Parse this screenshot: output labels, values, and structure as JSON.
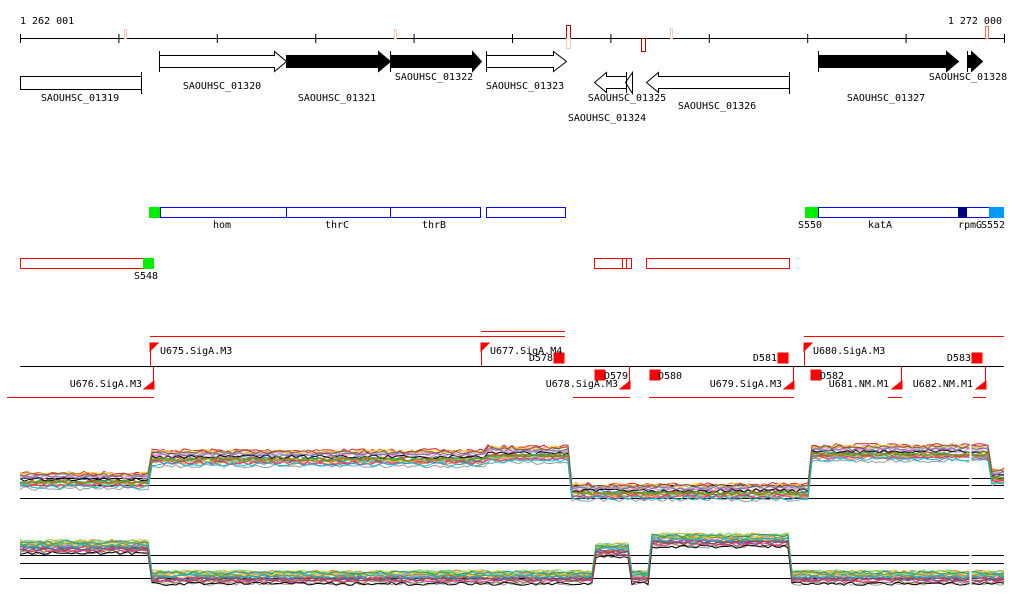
{
  "ruler": {
    "start_label": "1 262 001",
    "end_label": "1 272 000"
  },
  "genes": [
    {
      "id": "SAOUHSC_01319"
    },
    {
      "id": "SAOUHSC_01320"
    },
    {
      "id": "SAOUHSC_01321"
    },
    {
      "id": "SAOUHSC_01322"
    },
    {
      "id": "SAOUHSC_01323"
    },
    {
      "id": "SAOUHSC_01324"
    },
    {
      "id": "SAOUHSC_01325"
    },
    {
      "id": "SAOUHSC_01326"
    },
    {
      "id": "SAOUHSC_01327"
    },
    {
      "id": "SAOUHSC_01328"
    }
  ],
  "gene_names": {
    "hom": "hom",
    "thrC": "thrC",
    "thrB": "thrB",
    "katA": "katA",
    "rpmG": "rpmG",
    "S550": "S550",
    "S552": "S552",
    "S548": "S548"
  },
  "promoters": {
    "U675": "U675.SigA.M3",
    "U676": "U676.SigA.M3",
    "U677": "U677.SigA.M4",
    "U678": "U678.SigA.M3",
    "U679": "U679.SigA.M3",
    "U680": "U680.SigA.M3",
    "U681": "U681.NM.M1",
    "U682": "U682.NM.M1"
  },
  "terminators": {
    "D578": "D578",
    "D579": "D579",
    "D580": "D580",
    "D581": "D581",
    "D582": "D582",
    "D583": "D583"
  },
  "colors": {
    "promoter": "#ff0000",
    "gene_box": "#0000ff",
    "sRNA": "#00ee00",
    "navy": "#000080",
    "lightblue": "#0099ff"
  },
  "expression": {
    "track1_levels": [
      [
        0,
        0.55
      ],
      [
        0.133,
        0.25
      ],
      [
        0.473,
        0.2
      ],
      [
        0.557,
        0.7
      ],
      [
        0.802,
        0.18
      ],
      [
        0.986,
        0.5
      ]
    ],
    "track2_levels": [
      [
        0,
        0.25
      ],
      [
        0.133,
        0.72
      ],
      [
        0.583,
        0.3
      ],
      [
        0.62,
        0.72
      ],
      [
        0.639,
        0.15
      ],
      [
        0.784,
        0.72
      ]
    ]
  }
}
